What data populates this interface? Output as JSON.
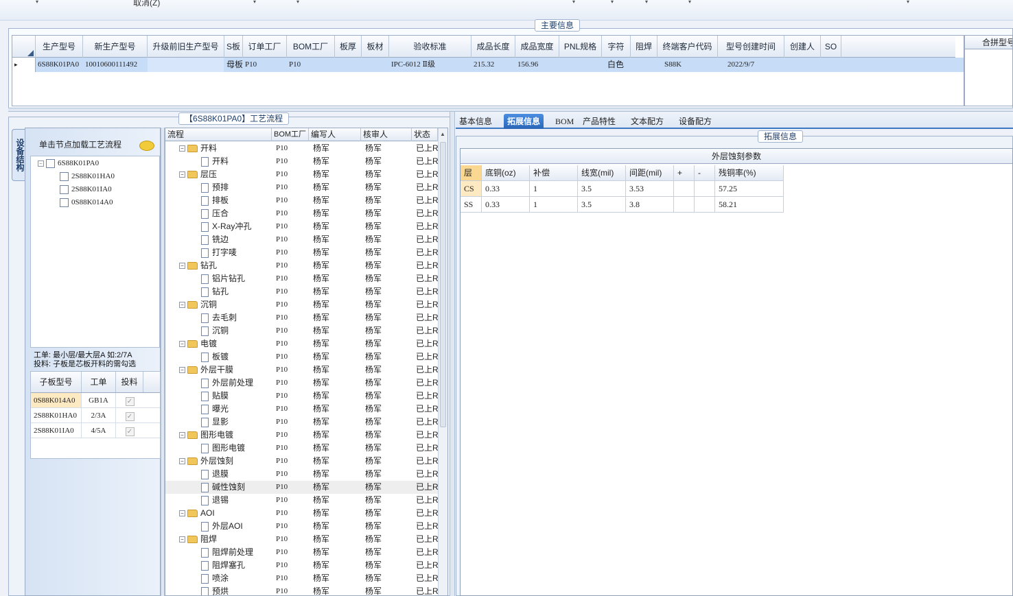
{
  "toolbar": {
    "cancel_label": "取消(Z)"
  },
  "main_info": {
    "title": "主要信息",
    "columns": [
      "生产型号",
      "新生产型号",
      "升级前旧生产型号",
      "S板",
      "订单工厂",
      "BOM工厂",
      "板厚",
      "板材",
      "验收标准",
      "成品长度",
      "成品宽度",
      "PNL规格",
      "字符",
      "阻焊",
      "终端客户代码",
      "型号创建时间",
      "创建人",
      "SO"
    ],
    "row": {
      "production_model": "6S88K01PA0",
      "new_model": "10010600111492",
      "old_model": "",
      "s_board": "母板",
      "order_factory": "P10",
      "bom_factory": "P10",
      "thickness": "",
      "material": "",
      "acceptance": "IPC-6012 Ⅱ级",
      "length": "215.32",
      "width": "156.96",
      "pnl": "",
      "char": "白色",
      "mask": "",
      "customer_code": "S88K",
      "created": "2022/9/7",
      "creator": "",
      "so": ""
    },
    "merge_label": "合拼型号"
  },
  "process_group_title": "【6S88K01PA0】工艺流程",
  "left_panel": {
    "vtab_label": "设备结构",
    "hint": "单击节点加载工艺流程",
    "tree": [
      "6S88K01PA0",
      "2S88K01HA0",
      "2S88K01IA0",
      "0S88K014A0"
    ],
    "note_line1": "工单: 最小层/最大层A 如:2/7A",
    "note_line2": "投料: 子板是芯板开料的需勾选",
    "sub_columns": [
      "子板型号",
      "工单",
      "投料"
    ],
    "sub_rows": [
      {
        "model": "0S88K014A0",
        "order": "GB1A"
      },
      {
        "model": "2S88K01HA0",
        "order": "2/3A"
      },
      {
        "model": "2S88K01IA0",
        "order": "4/5A"
      }
    ]
  },
  "process_tree": {
    "columns": [
      "流程",
      "BOM工厂",
      "编写人",
      "核审人",
      "状态"
    ],
    "rows": [
      {
        "name": "开料",
        "folder": true,
        "factory": "P10",
        "writer": "杨军",
        "reviewer": "杨军",
        "status": "已上R"
      },
      {
        "name": "开料",
        "folder": false,
        "factory": "P10",
        "writer": "杨军",
        "reviewer": "杨军",
        "status": "已上R"
      },
      {
        "name": "层压",
        "folder": true,
        "factory": "P10",
        "writer": "杨军",
        "reviewer": "杨军",
        "status": "已上R"
      },
      {
        "name": "预排",
        "folder": false,
        "factory": "P10",
        "writer": "杨军",
        "reviewer": "杨军",
        "status": "已上R"
      },
      {
        "name": "排板",
        "folder": false,
        "factory": "P10",
        "writer": "杨军",
        "reviewer": "杨军",
        "status": "已上R"
      },
      {
        "name": "压合",
        "folder": false,
        "factory": "P10",
        "writer": "杨军",
        "reviewer": "杨军",
        "status": "已上R"
      },
      {
        "name": "X-Ray冲孔",
        "folder": false,
        "factory": "P10",
        "writer": "杨军",
        "reviewer": "杨军",
        "status": "已上R"
      },
      {
        "name": "铣边",
        "folder": false,
        "factory": "P10",
        "writer": "杨军",
        "reviewer": "杨军",
        "status": "已上R"
      },
      {
        "name": "打字唛",
        "folder": false,
        "factory": "P10",
        "writer": "杨军",
        "reviewer": "杨军",
        "status": "已上R"
      },
      {
        "name": "钻孔",
        "folder": true,
        "factory": "P10",
        "writer": "杨军",
        "reviewer": "杨军",
        "status": "已上R"
      },
      {
        "name": "铝片钻孔",
        "folder": false,
        "factory": "P10",
        "writer": "杨军",
        "reviewer": "杨军",
        "status": "已上R"
      },
      {
        "name": "钻孔",
        "folder": false,
        "factory": "P10",
        "writer": "杨军",
        "reviewer": "杨军",
        "status": "已上R"
      },
      {
        "name": "沉铜",
        "folder": true,
        "factory": "P10",
        "writer": "杨军",
        "reviewer": "杨军",
        "status": "已上R"
      },
      {
        "name": "去毛刺",
        "folder": false,
        "factory": "P10",
        "writer": "杨军",
        "reviewer": "杨军",
        "status": "已上R"
      },
      {
        "name": "沉铜",
        "folder": false,
        "factory": "P10",
        "writer": "杨军",
        "reviewer": "杨军",
        "status": "已上R"
      },
      {
        "name": "电镀",
        "folder": true,
        "factory": "P10",
        "writer": "杨军",
        "reviewer": "杨军",
        "status": "已上R"
      },
      {
        "name": "板镀",
        "folder": false,
        "factory": "P10",
        "writer": "杨军",
        "reviewer": "杨军",
        "status": "已上R"
      },
      {
        "name": "外层干膜",
        "folder": true,
        "factory": "P10",
        "writer": "杨军",
        "reviewer": "杨军",
        "status": "已上R"
      },
      {
        "name": "外层前处理",
        "folder": false,
        "factory": "P10",
        "writer": "杨军",
        "reviewer": "杨军",
        "status": "已上R"
      },
      {
        "name": "贴膜",
        "folder": false,
        "factory": "P10",
        "writer": "杨军",
        "reviewer": "杨军",
        "status": "已上R"
      },
      {
        "name": "曝光",
        "folder": false,
        "factory": "P10",
        "writer": "杨军",
        "reviewer": "杨军",
        "status": "已上R"
      },
      {
        "name": "显影",
        "folder": false,
        "factory": "P10",
        "writer": "杨军",
        "reviewer": "杨军",
        "status": "已上R"
      },
      {
        "name": "图形电镀",
        "folder": true,
        "factory": "P10",
        "writer": "杨军",
        "reviewer": "杨军",
        "status": "已上R"
      },
      {
        "name": "图形电镀",
        "folder": false,
        "factory": "P10",
        "writer": "杨军",
        "reviewer": "杨军",
        "status": "已上R"
      },
      {
        "name": "外层蚀刻",
        "folder": true,
        "factory": "P10",
        "writer": "杨军",
        "reviewer": "杨军",
        "status": "已上R"
      },
      {
        "name": "退膜",
        "folder": false,
        "factory": "P10",
        "writer": "杨军",
        "reviewer": "杨军",
        "status": "已上R"
      },
      {
        "name": "碱性蚀刻",
        "folder": false,
        "factory": "P10",
        "writer": "杨军",
        "reviewer": "杨军",
        "status": "已上R",
        "selected": true
      },
      {
        "name": "退锡",
        "folder": false,
        "factory": "P10",
        "writer": "杨军",
        "reviewer": "杨军",
        "status": "已上R"
      },
      {
        "name": "AOI",
        "folder": true,
        "factory": "P10",
        "writer": "杨军",
        "reviewer": "杨军",
        "status": "已上R"
      },
      {
        "name": "外层AOI",
        "folder": false,
        "factory": "P10",
        "writer": "杨军",
        "reviewer": "杨军",
        "status": "已上R"
      },
      {
        "name": "阻焊",
        "folder": true,
        "factory": "P10",
        "writer": "杨军",
        "reviewer": "杨军",
        "status": "已上R"
      },
      {
        "name": "阻焊前处理",
        "folder": false,
        "factory": "P10",
        "writer": "杨军",
        "reviewer": "杨军",
        "status": "已上R"
      },
      {
        "name": "阻焊塞孔",
        "folder": false,
        "factory": "P10",
        "writer": "杨军",
        "reviewer": "杨军",
        "status": "已上R"
      },
      {
        "name": "喷涂",
        "folder": false,
        "factory": "P10",
        "writer": "杨军",
        "reviewer": "杨军",
        "status": "已上R"
      },
      {
        "name": "预烘",
        "folder": false,
        "factory": "P10",
        "writer": "杨军",
        "reviewer": "杨军",
        "status": "已上R"
      }
    ]
  },
  "tabs": [
    "基本信息",
    "拓展信息",
    "BOM",
    "产品特性",
    "文本配方",
    "设备配方"
  ],
  "active_tab": "拓展信息",
  "ext_group_title": "拓展信息",
  "etch_params": {
    "title": "外层蚀刻参数",
    "columns": [
      "层",
      "底铜(oz)",
      "补偿",
      "线宽(mil)",
      "间距(mil)",
      "+",
      "-",
      "残铜率(%)"
    ],
    "rows": [
      [
        "CS",
        "0.33",
        "1",
        "3.5",
        "3.53",
        "",
        "",
        "57.25"
      ],
      [
        "SS",
        "0.33",
        "1",
        "3.5",
        "3.8",
        "",
        "",
        "58.21"
      ]
    ]
  },
  "colors": {
    "accent": "#2a66b8",
    "selected_row": "#c7dcf7",
    "header_bg": "#e3eaf4"
  }
}
